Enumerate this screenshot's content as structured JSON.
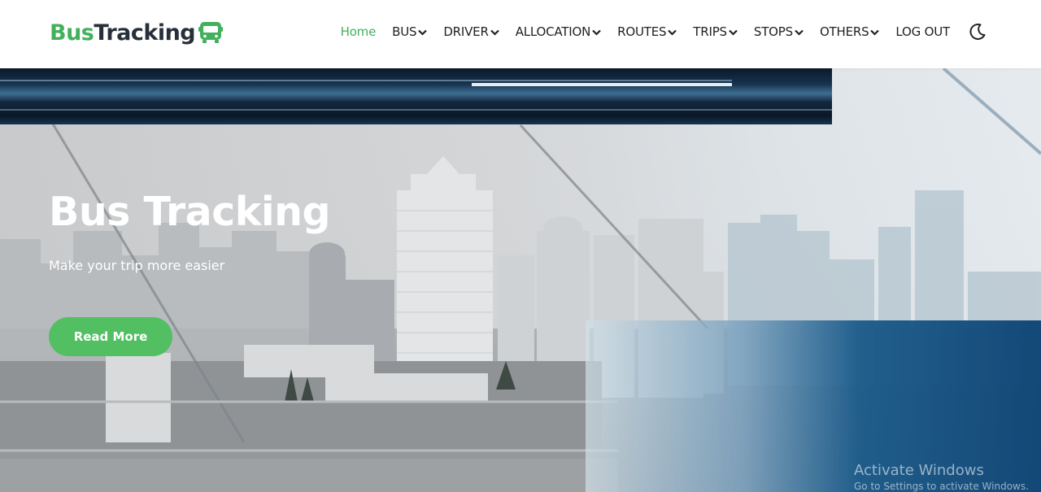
{
  "brand": {
    "part1": "Bus",
    "part2": "Tracking",
    "icon": "bus-icon"
  },
  "nav": {
    "items": [
      {
        "label": "Home",
        "dropdown": false,
        "active": true
      },
      {
        "label": "BUS",
        "dropdown": true
      },
      {
        "label": "DRIVER",
        "dropdown": true
      },
      {
        "label": "ALLOCATION",
        "dropdown": true
      },
      {
        "label": "ROUTES",
        "dropdown": true
      },
      {
        "label": "TRIPS",
        "dropdown": true
      },
      {
        "label": "STOPS",
        "dropdown": true
      },
      {
        "label": "OTHERS",
        "dropdown": true
      },
      {
        "label": "LOG OUT",
        "dropdown": false
      }
    ],
    "theme_toggle_icon": "moon-icon"
  },
  "hero": {
    "title": "Bus Tracking",
    "subtitle": "Make your trip more easier",
    "button_label": "Read More"
  },
  "watermark": {
    "title": "Activate Windows",
    "subtitle": "Go to Settings to activate Windows."
  },
  "colors": {
    "accent": "#43b05c",
    "button": "#52bf63",
    "brand_dark": "#27303a"
  }
}
